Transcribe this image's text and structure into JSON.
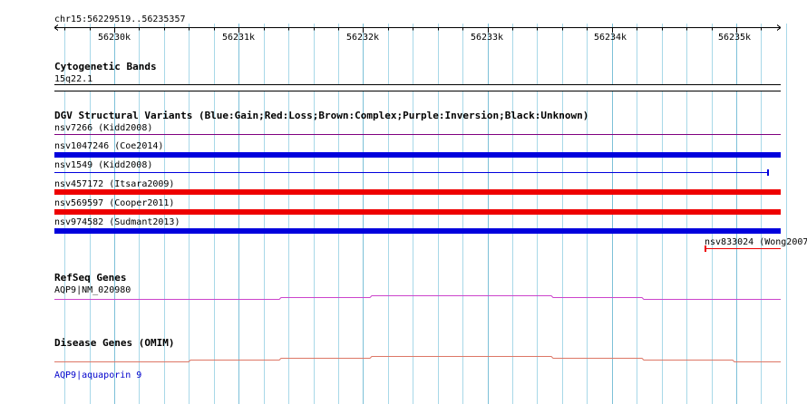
{
  "locus": "chr15:56229519..56235357",
  "ruler": {
    "ticks": [
      "56230k",
      "56231k",
      "56232k",
      "56233k",
      "56234k",
      "56235k"
    ]
  },
  "cytoband": {
    "title": "Cytogenetic Bands",
    "band": "15q22.1"
  },
  "dgv": {
    "title": "DGV Structural Variants (Blue:Gain;Red:Loss;Brown:Complex;Purple:Inversion;Black:Unknown)",
    "variants": [
      {
        "label": "nsv7266 (Kidd2008)",
        "type": "inversion",
        "color": "#800080"
      },
      {
        "label": "nsv1047246 (Coe2014)",
        "type": "gain",
        "color": "#0000dd"
      },
      {
        "label": "nsv1549 (Kidd2008)",
        "type": "gain",
        "color": "#0000dd"
      },
      {
        "label": "nsv457172 (Itsara2009)",
        "type": "loss",
        "color": "#ee0000"
      },
      {
        "label": "nsv569597 (Cooper2011)",
        "type": "loss",
        "color": "#ee0000"
      },
      {
        "label": "nsv974582 (Sudmant2013)",
        "type": "gain",
        "color": "#0000dd"
      },
      {
        "label": "nsv833024 (Wong2007",
        "type": "loss",
        "color": "#ee0000"
      }
    ]
  },
  "refseq": {
    "title": "RefSeq Genes",
    "gene": "AQP9|NM_020980",
    "color": "#cc44cc"
  },
  "omim": {
    "title": "Disease Genes (OMIM)",
    "gene": "AQP9|aquaporin 9",
    "color": "#dd7766"
  },
  "colors": {
    "grid": "#a8d8e8",
    "grid_major": "#7cc0d8",
    "link": "#0000cc"
  }
}
